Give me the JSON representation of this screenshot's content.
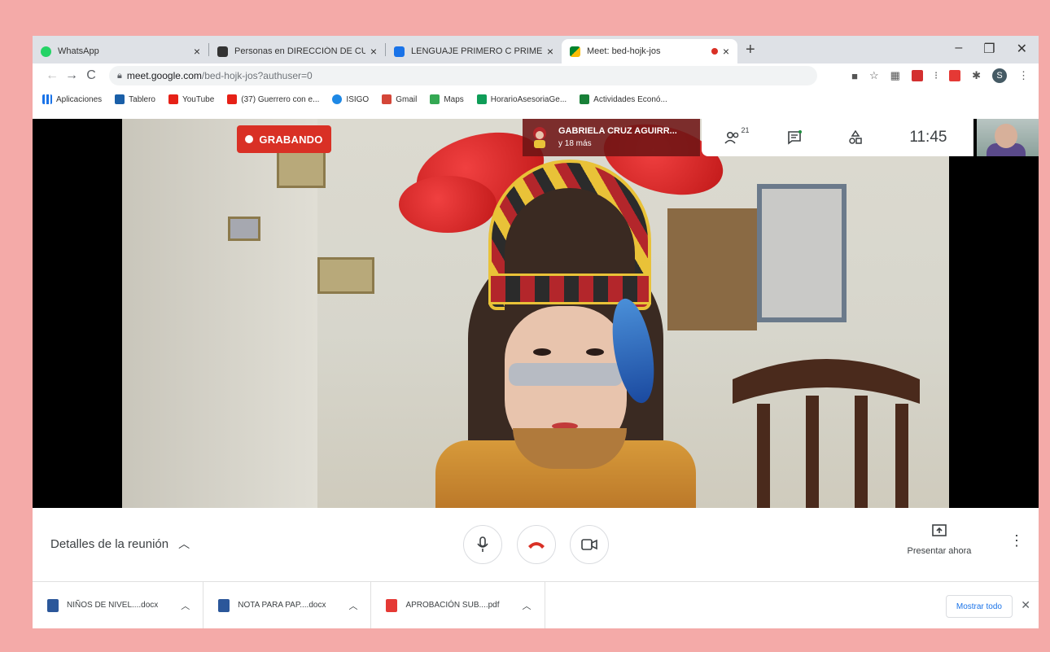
{
  "tabs": [
    {
      "label": "WhatsApp",
      "favicon_color": "#25d366"
    },
    {
      "label": "Personas en DIRECCIÓN DE CURS",
      "favicon_color": "#333333"
    },
    {
      "label": "LENGUAJE PRIMERO C PRIMERO",
      "favicon_color": "#1a73e8"
    },
    {
      "label": "Meet: bed-hojk-jos",
      "favicon_color": "#00832d",
      "active": true,
      "recording": true
    }
  ],
  "tab_close_glyph": "×",
  "new_tab_glyph": "+",
  "window_controls": {
    "minimize": "–",
    "restore": "❐",
    "close": "✕"
  },
  "address": {
    "domain": "meet.google.com",
    "path": "/bed-hojk-jos?authuser=0"
  },
  "nav": {
    "back": "←",
    "forward": "→",
    "reload": "C"
  },
  "profile_initial": "S",
  "bookmarks": [
    {
      "label": "Aplicaciones",
      "color": "#1a73e8"
    },
    {
      "label": "Tablero",
      "color": "#1a5fa8"
    },
    {
      "label": "YouTube",
      "color": "#e62117"
    },
    {
      "label": "(37) Guerrero con e...",
      "color": "#e62117"
    },
    {
      "label": "ISIGO",
      "color": "#1e88e5"
    },
    {
      "label": "Gmail",
      "color": "#d44638"
    },
    {
      "label": "Maps",
      "color": "#34a853"
    },
    {
      "label": "HorarioAsesoriaGe...",
      "color": "#0f9d58"
    },
    {
      "label": "Actividades Econó...",
      "color": "#188038"
    }
  ],
  "meet": {
    "recording_label": "GRABANDO",
    "presenter_name": "GABRIELA CRUZ AGUIRR...",
    "presenter_more": "y 18 más",
    "people_count": "21",
    "clock": "11:45",
    "meeting_details": "Detalles de la reunión",
    "present_now": "Presentar ahora"
  },
  "downloads": [
    {
      "name": "NIÑOS DE NIVEL....docx",
      "type": "docx",
      "color": "#2b579a"
    },
    {
      "name": "NOTA PARA PAP....docx",
      "type": "docx",
      "color": "#2b579a"
    },
    {
      "name": "APROBACIÓN SUB....pdf",
      "type": "pdf",
      "color": "#e53935"
    }
  ],
  "show_all_label": "Mostrar todo",
  "colors": {
    "record_red": "#d93025",
    "accent_blue": "#1a73e8",
    "frame_pink": "#f4aaa8"
  }
}
